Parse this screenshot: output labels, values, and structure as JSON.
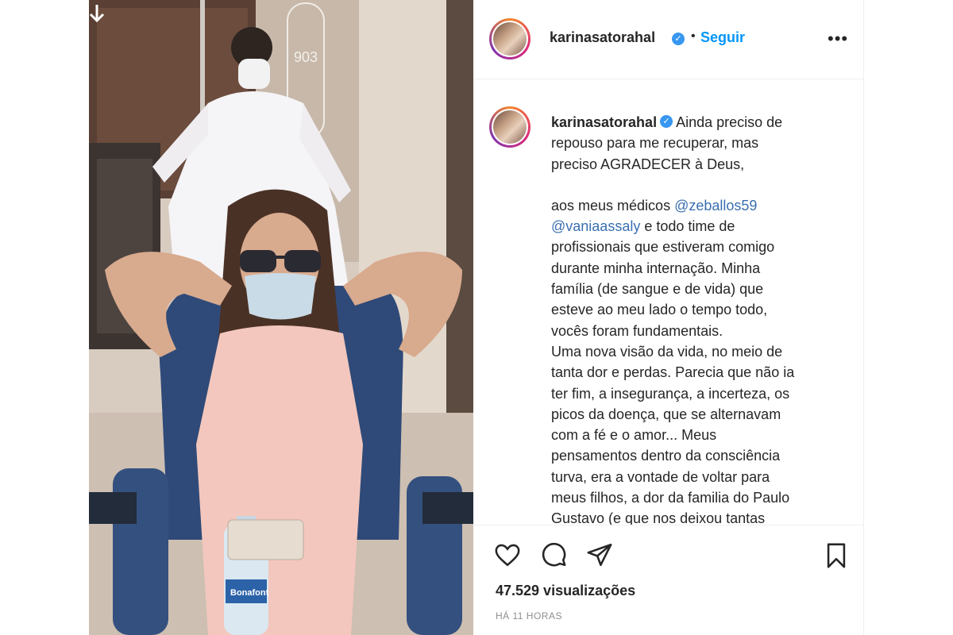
{
  "post": {
    "username": "karinasatorahal",
    "follow_label": "Seguir",
    "separator": "•",
    "more_label": "•••",
    "photo_label_903": "903",
    "bottle_label": "Bonafont",
    "caption": {
      "line1": "Ainda preciso de",
      "line2": "repouso para me recuperar, mas",
      "line3": "preciso AGRADECER à Deus,",
      "line4_prefix": "aos meus médicos ",
      "mention1": "@zeballos59",
      "mention2": "@vaniaassaly",
      "line5_suffix": " e todo time de",
      "line6": "profissionais que estiveram comigo",
      "line7": "durante minha internação. Minha",
      "line8": "família (de sangue e de vida) que",
      "line9": "esteve ao meu lado o tempo todo,",
      "line10": "vocês foram fundamentais.",
      "line11": "Uma nova visão da vida, no meio de",
      "line12": "tanta dor e perdas. Parecia que não ia",
      "line13": "ter fim, a insegurança, a incerteza, os",
      "line14": "picos da doença, que se alternavam",
      "line15": "com a fé e o amor... Meus",
      "line16": "pensamentos dentro da consciência",
      "line17": "turva, era a vontade de voltar para",
      "line18": "meus filhos, a dor da familia do Paulo",
      "line19": "Gustavo (e que nos deixou tantas"
    },
    "views": "47.529 visualizações",
    "time_ago": "HÁ 11 HORAS"
  },
  "icons": {
    "like": "heart-icon",
    "comment": "comment-icon",
    "share": "send-icon",
    "save": "bookmark-icon",
    "verified": "verified-badge-icon",
    "download": "down-arrow-icon"
  },
  "colors": {
    "link": "#0095f6",
    "verified": "#3897f0",
    "meta": "#8e8e8e"
  }
}
